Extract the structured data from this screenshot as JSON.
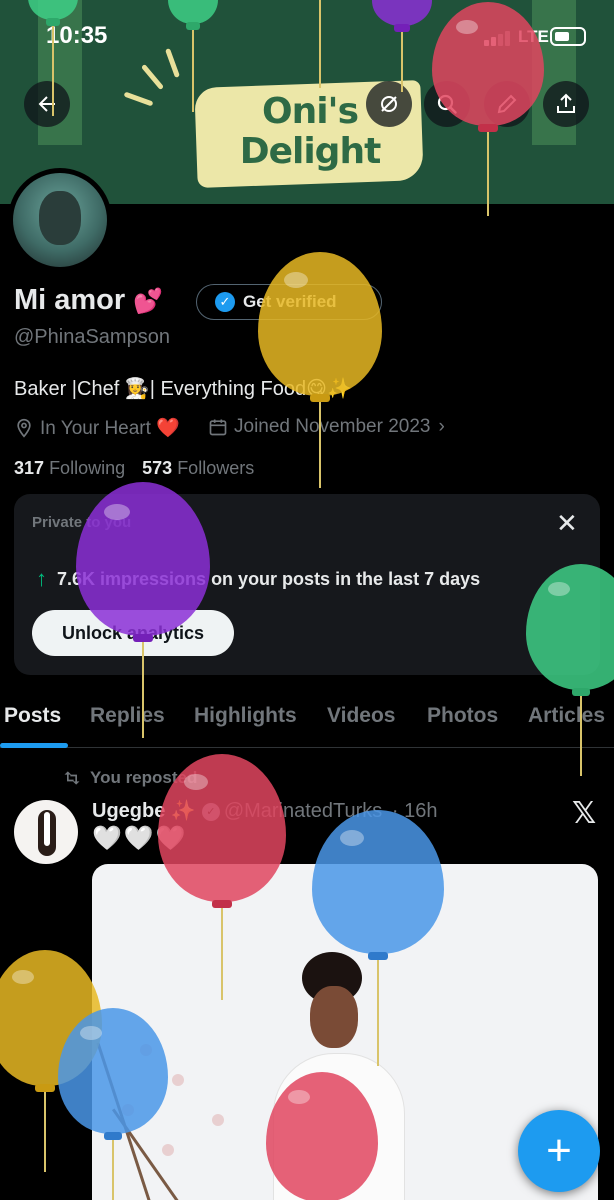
{
  "status_bar": {
    "time": "10:35",
    "network": "LTE"
  },
  "banner": {
    "brand_line1": "Oni's",
    "brand_line2": "Delight"
  },
  "header_icons": [
    "back-arrow-icon",
    "grok-icon",
    "search-icon",
    "edit-icon",
    "share-icon"
  ],
  "profile": {
    "name": "Mi amor",
    "name_emoji": "💕",
    "get_verified_label": "Get verified",
    "handle": "@PhinaSampson",
    "bio": "Baker |Chef 👩‍🍳| Everything Food😋✨",
    "location": "In Your Heart ❤️",
    "joined": "Joined November 2023",
    "following_count": "317",
    "following_label": "Following",
    "followers_count": "573",
    "followers_label": "Followers"
  },
  "analytics_card": {
    "private_label": "Private to you",
    "impressions_text": "7.6K impressions on your posts in the last 7 days",
    "unlock_label": "Unlock analytics"
  },
  "tabs": [
    {
      "label": "Posts",
      "active": true
    },
    {
      "label": "Replies",
      "active": false
    },
    {
      "label": "Highlights",
      "active": false
    },
    {
      "label": "Videos",
      "active": false
    },
    {
      "label": "Photos",
      "active": false
    },
    {
      "label": "Articles",
      "active": false
    }
  ],
  "post": {
    "repost_label": "You reposted",
    "author_name": "Ugegbe ✨",
    "author_handle": "@MarinatedTurks",
    "time_ago": "· 16h",
    "text": "🤍🤍🤍"
  },
  "colors": {
    "accent": "#1d9bf0",
    "banner_green": "#20523a",
    "balloon_red": "#e0455f",
    "balloon_yellow": "#e8b923",
    "balloon_purple": "#8b2fd6",
    "balloon_green": "#3ecf86",
    "balloon_blue": "#4a97e8"
  }
}
